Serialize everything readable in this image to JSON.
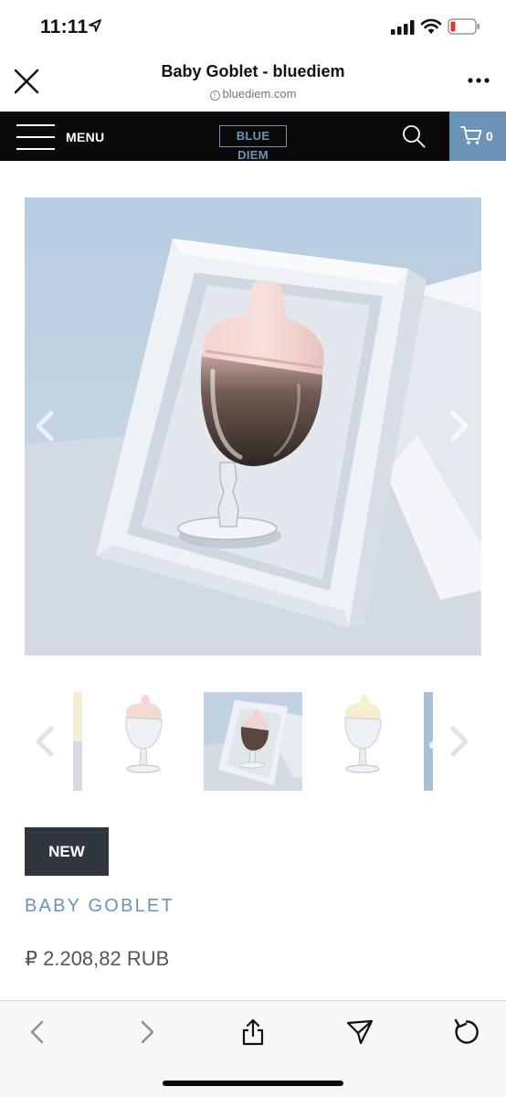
{
  "status_bar": {
    "time": "11:11"
  },
  "browser": {
    "title": "Baby Goblet - bluediem",
    "url": "bluediem.com"
  },
  "site_nav": {
    "menu_label": "MENU",
    "logo_text": "BLUE DIEM",
    "cart_count": "0"
  },
  "product": {
    "badge": "NEW",
    "name": "BABY GOBLET",
    "price": "₽ 2.208,82 RUB"
  },
  "gallery": {
    "thumbnail_count": 5,
    "selected_thumbnail_index": 2
  },
  "colors": {
    "brand_blue": "#6b93b5",
    "nav_black": "#0a0a0a",
    "badge_dark": "#2f363d",
    "price_gray": "#555555"
  }
}
